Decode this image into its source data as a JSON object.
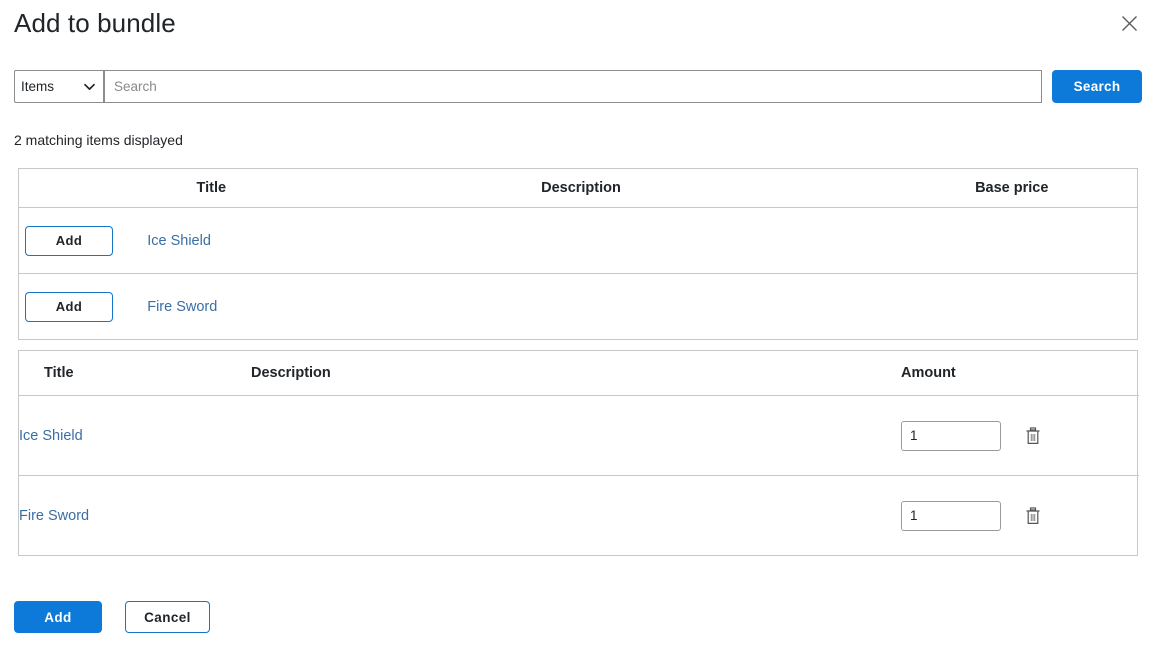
{
  "dialog": {
    "title": "Add to bundle",
    "close_icon": "close-icon"
  },
  "search": {
    "type_selected": "Items",
    "type_options": [
      "Items"
    ],
    "placeholder": "Search",
    "value": "",
    "button_label": "Search",
    "chevron_icon": "chevron-down-icon"
  },
  "results": {
    "count_text": "2 matching items displayed",
    "headers": {
      "action": "",
      "title": "Title",
      "description": "Description",
      "base_price": "Base price"
    },
    "rows": [
      {
        "add_label": "Add",
        "title": "Ice Shield",
        "description": "",
        "base_price": ""
      },
      {
        "add_label": "Add",
        "title": "Fire Sword",
        "description": "",
        "base_price": ""
      }
    ]
  },
  "bundle": {
    "headers": {
      "title": "Title",
      "description": "Description",
      "amount": "Amount"
    },
    "rows": [
      {
        "title": "Ice Shield",
        "description": "",
        "amount": "1",
        "delete_icon": "trash-icon"
      },
      {
        "title": "Fire Sword",
        "description": "",
        "amount": "1",
        "delete_icon": "trash-icon"
      }
    ]
  },
  "footer": {
    "add_label": "Add",
    "cancel_label": "Cancel"
  },
  "colors": {
    "primary_blue": "#0d7ad9",
    "link_blue": "#3a6ea5",
    "border_gray": "#c8c8c8",
    "text": "#212529"
  }
}
